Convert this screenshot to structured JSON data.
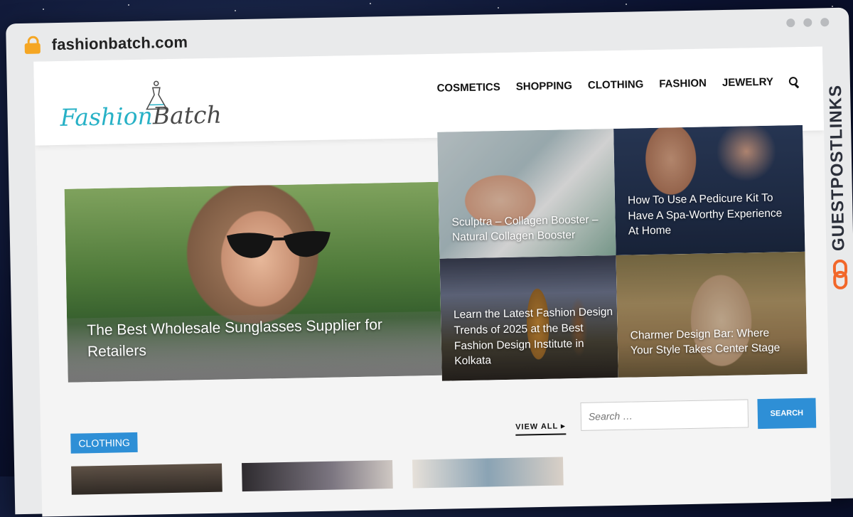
{
  "browser": {
    "url": "fashionbatch.com"
  },
  "site": {
    "logo_part1": "Fashion",
    "logo_part2": "Batch",
    "nav": [
      "COSMETICS",
      "SHOPPING",
      "CLOTHING",
      "FASHION",
      "JEWELRY"
    ]
  },
  "featured": {
    "main": "The Best Wholesale Sunglasses Supplier for Retailers",
    "side": [
      "Sculptra – Collagen Booster – Natural Collagen Booster",
      "How To Use A Pedicure Kit To Have A Spa-Worthy Experience At Home",
      "Learn the Latest Fashion Design Trends of 2025 at the Best Fashion Design Institute in Kolkata",
      "Charmer Design Bar: Where Your Style Takes Center Stage"
    ]
  },
  "section": {
    "category": "CLOTHING",
    "view_all": "VIEW ALL ▸"
  },
  "sidebar_search": {
    "placeholder": "Search …",
    "button": "SEARCH"
  },
  "watermark": "GUESTPOSTLINKS",
  "colors": {
    "accent": "#2e8fd6",
    "logo_teal": "#27b1c6",
    "lock": "#f5a623"
  }
}
